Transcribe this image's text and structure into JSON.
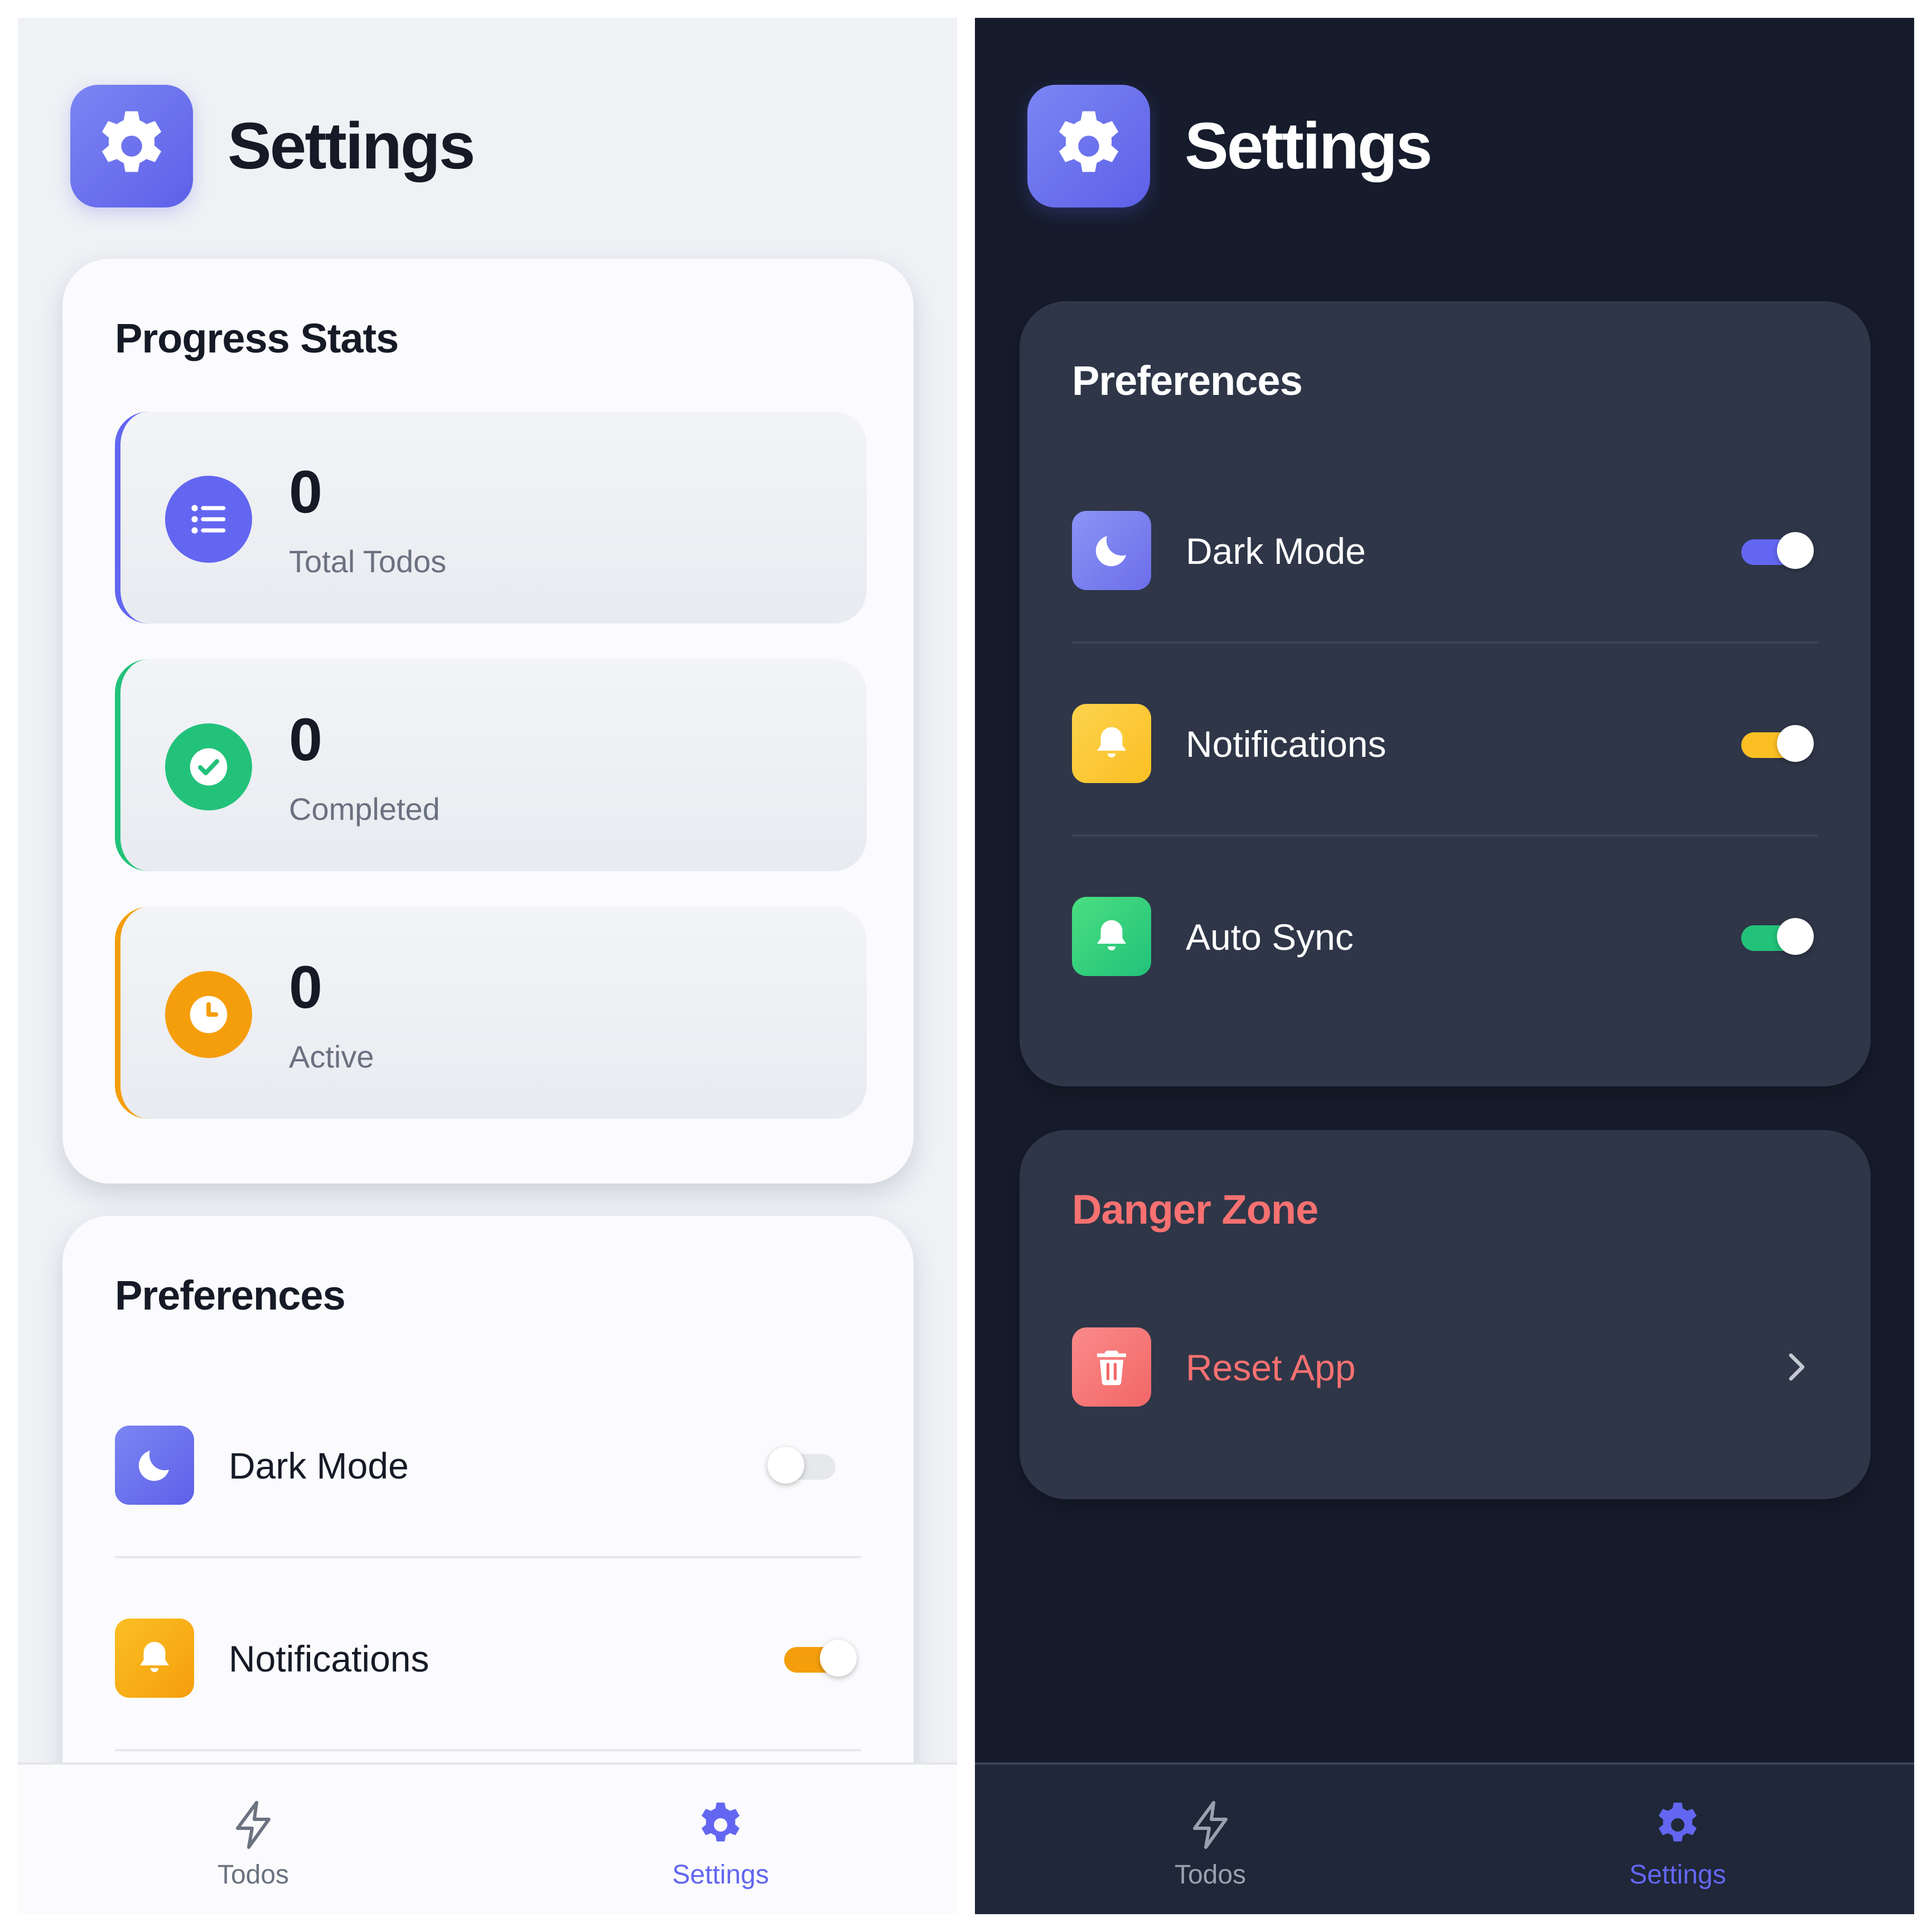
{
  "colors": {
    "accent": "#6366f1",
    "success": "#22c27a",
    "warning": "#f59e0b",
    "danger": "#f87171"
  },
  "light": {
    "header": {
      "title": "Settings",
      "icon": "gear-icon"
    },
    "progress_stats": {
      "title": "Progress Stats",
      "items": [
        {
          "value": "0",
          "label": "Total Todos",
          "icon": "list-icon",
          "color": "#6366f1"
        },
        {
          "value": "0",
          "label": "Completed",
          "icon": "check-circle-icon",
          "color": "#22c27a"
        },
        {
          "value": "0",
          "label": "Active",
          "icon": "clock-icon",
          "color": "#f59e0b"
        }
      ]
    },
    "preferences": {
      "title": "Preferences",
      "items": [
        {
          "label": "Dark Mode",
          "icon": "moon-icon",
          "enabled": false
        },
        {
          "label": "Notifications",
          "icon": "bell-icon",
          "enabled": true
        }
      ]
    },
    "nav": {
      "items": [
        {
          "label": "Todos",
          "icon": "lightning-icon",
          "active": false
        },
        {
          "label": "Settings",
          "icon": "gear-icon",
          "active": true
        }
      ]
    }
  },
  "dark": {
    "header": {
      "title": "Settings",
      "icon": "gear-icon"
    },
    "preferences": {
      "title": "Preferences",
      "items": [
        {
          "label": "Dark Mode",
          "icon": "moon-icon",
          "enabled": true
        },
        {
          "label": "Notifications",
          "icon": "bell-icon",
          "enabled": true
        },
        {
          "label": "Auto Sync",
          "icon": "bell-icon",
          "enabled": true
        }
      ]
    },
    "danger_zone": {
      "title": "Danger Zone",
      "items": [
        {
          "label": "Reset App",
          "icon": "trash-icon"
        }
      ]
    },
    "nav": {
      "items": [
        {
          "label": "Todos",
          "icon": "lightning-icon",
          "active": false
        },
        {
          "label": "Settings",
          "icon": "gear-icon",
          "active": true
        }
      ]
    }
  }
}
